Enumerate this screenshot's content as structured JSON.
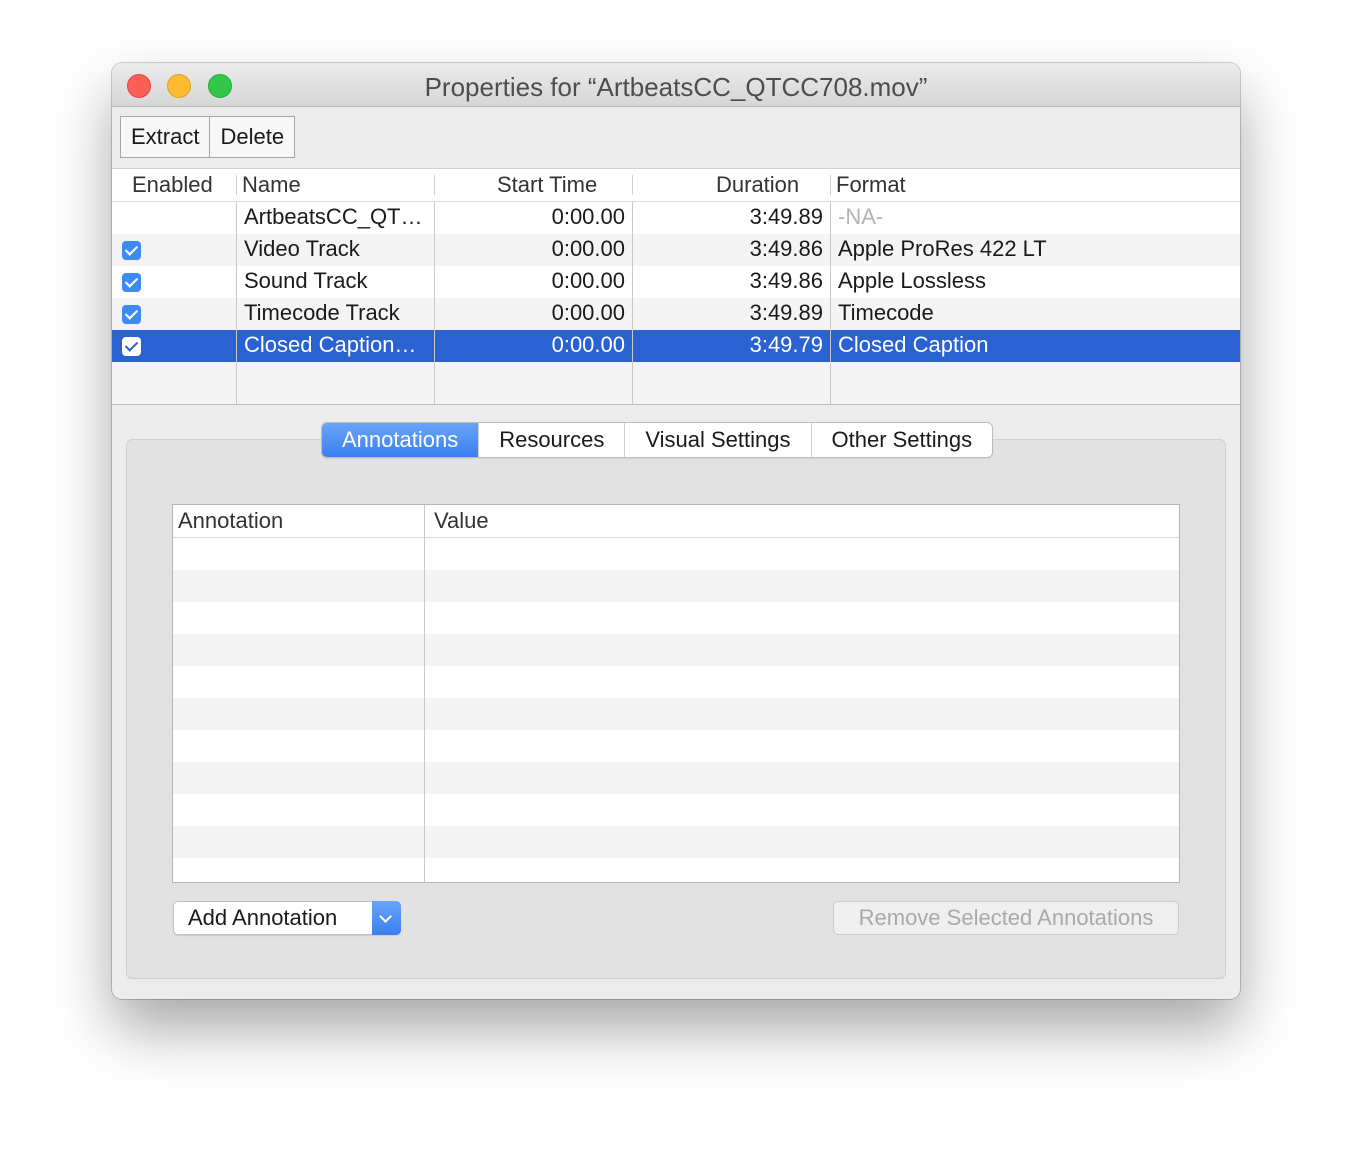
{
  "window": {
    "title": "Properties for “ArtbeatsCC_QTCC708.mov”"
  },
  "toolbar": {
    "extract_label": "Extract",
    "delete_label": "Delete"
  },
  "tracks_table": {
    "columns": [
      "Enabled",
      "Name",
      "Start Time",
      "Duration",
      "Format"
    ],
    "rows": [
      {
        "enabled": false,
        "name": "ArtbeatsCC_QT…",
        "start": "0:00.00",
        "duration": "3:49.89",
        "format": "-NA-"
      },
      {
        "enabled": true,
        "name": "Video Track",
        "start": "0:00.00",
        "duration": "3:49.86",
        "format": "Apple ProRes 422 LT"
      },
      {
        "enabled": true,
        "name": "Sound Track",
        "start": "0:00.00",
        "duration": "3:49.86",
        "format": "Apple Lossless"
      },
      {
        "enabled": true,
        "name": "Timecode Track",
        "start": "0:00.00",
        "duration": "3:49.89",
        "format": "Timecode"
      },
      {
        "enabled": true,
        "name": "Closed Caption…",
        "start": "0:00.00",
        "duration": "3:49.79",
        "format": "Closed Caption",
        "selected": true
      }
    ]
  },
  "tabs": [
    "Annotations",
    "Resources",
    "Visual Settings",
    "Other Settings"
  ],
  "active_tab": "Annotations",
  "annotations_table": {
    "columns": [
      "Annotation",
      "Value"
    ],
    "rows": []
  },
  "buttons": {
    "add_annotation": "Add Annotation",
    "remove_selected": "Remove Selected Annotations"
  },
  "colors": {
    "selection": "#2a62d2",
    "accent": "#3a7ff1"
  }
}
